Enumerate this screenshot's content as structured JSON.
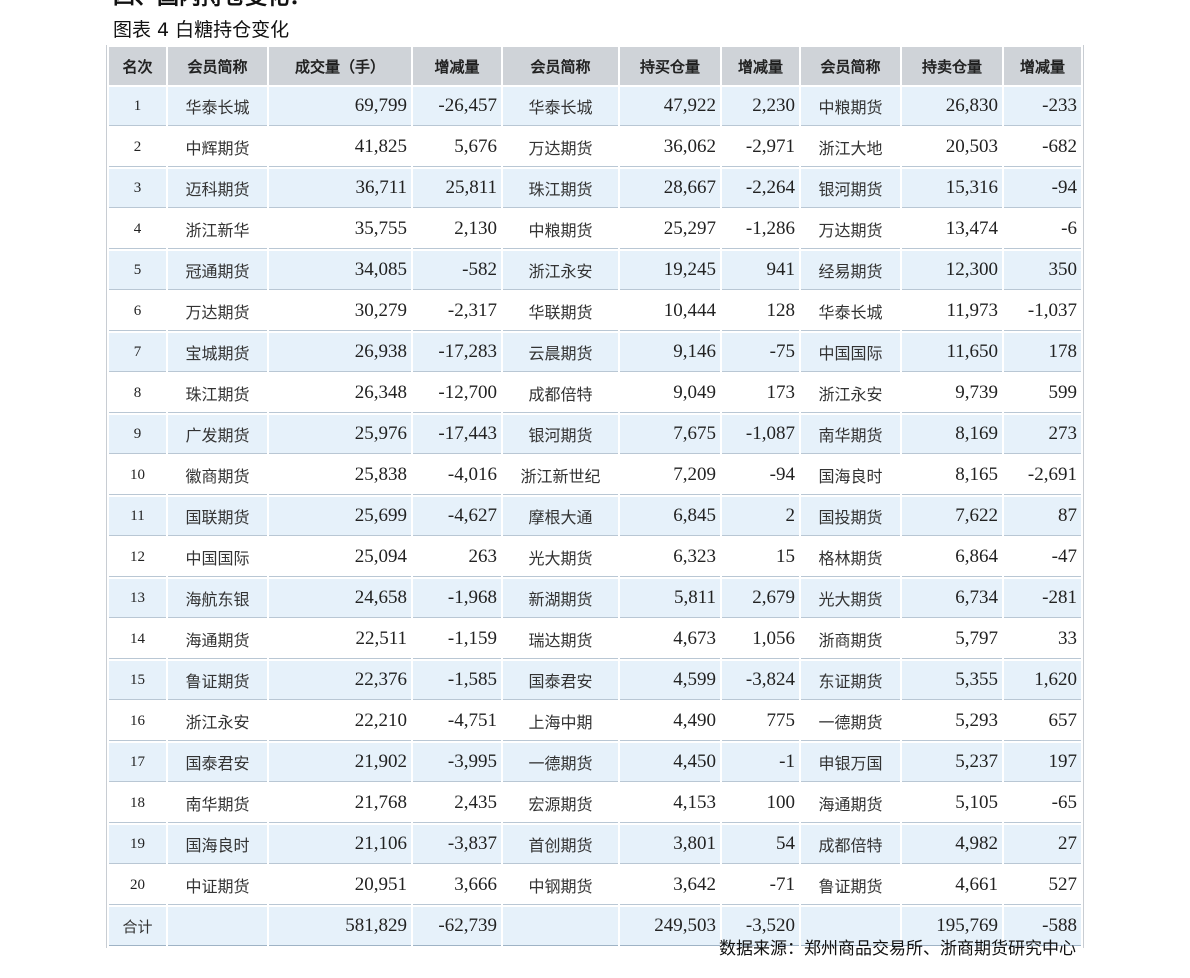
{
  "section_heading": "四、国内持仓变化：",
  "figure_title": "图表 4  白糖持仓变化",
  "columns": [
    "名次",
    "会员简称",
    "成交量（手）",
    "增减量",
    "会员简称",
    "持买仓量",
    "增减量",
    "会员简称",
    "持卖仓量",
    "增减量"
  ],
  "rows": [
    [
      "1",
      "华泰长城",
      "69,799",
      "-26,457",
      "华泰长城",
      "47,922",
      "2,230",
      "中粮期货",
      "26,830",
      "-233"
    ],
    [
      "2",
      "中辉期货",
      "41,825",
      "5,676",
      "万达期货",
      "36,062",
      "-2,971",
      "浙江大地",
      "20,503",
      "-682"
    ],
    [
      "3",
      "迈科期货",
      "36,711",
      "25,811",
      "珠江期货",
      "28,667",
      "-2,264",
      "银河期货",
      "15,316",
      "-94"
    ],
    [
      "4",
      "浙江新华",
      "35,755",
      "2,130",
      "中粮期货",
      "25,297",
      "-1,286",
      "万达期货",
      "13,474",
      "-6"
    ],
    [
      "5",
      "冠通期货",
      "34,085",
      "-582",
      "浙江永安",
      "19,245",
      "941",
      "经易期货",
      "12,300",
      "350"
    ],
    [
      "6",
      "万达期货",
      "30,279",
      "-2,317",
      "华联期货",
      "10,444",
      "128",
      "华泰长城",
      "11,973",
      "-1,037"
    ],
    [
      "7",
      "宝城期货",
      "26,938",
      "-17,283",
      "云晨期货",
      "9,146",
      "-75",
      "中国国际",
      "11,650",
      "178"
    ],
    [
      "8",
      "珠江期货",
      "26,348",
      "-12,700",
      "成都倍特",
      "9,049",
      "173",
      "浙江永安",
      "9,739",
      "599"
    ],
    [
      "9",
      "广发期货",
      "25,976",
      "-17,443",
      "银河期货",
      "7,675",
      "-1,087",
      "南华期货",
      "8,169",
      "273"
    ],
    [
      "10",
      "徽商期货",
      "25,838",
      "-4,016",
      "浙江新世纪",
      "7,209",
      "-94",
      "国海良时",
      "8,165",
      "-2,691"
    ],
    [
      "11",
      "国联期货",
      "25,699",
      "-4,627",
      "摩根大通",
      "6,845",
      "2",
      "国投期货",
      "7,622",
      "87"
    ],
    [
      "12",
      "中国国际",
      "25,094",
      "263",
      "光大期货",
      "6,323",
      "15",
      "格林期货",
      "6,864",
      "-47"
    ],
    [
      "13",
      "海航东银",
      "24,658",
      "-1,968",
      "新湖期货",
      "5,811",
      "2,679",
      "光大期货",
      "6,734",
      "-281"
    ],
    [
      "14",
      "海通期货",
      "22,511",
      "-1,159",
      "瑞达期货",
      "4,673",
      "1,056",
      "浙商期货",
      "5,797",
      "33"
    ],
    [
      "15",
      "鲁证期货",
      "22,376",
      "-1,585",
      "国泰君安",
      "4,599",
      "-3,824",
      "东证期货",
      "5,355",
      "1,620"
    ],
    [
      "16",
      "浙江永安",
      "22,210",
      "-4,751",
      "上海中期",
      "4,490",
      "775",
      "一德期货",
      "5,293",
      "657"
    ],
    [
      "17",
      "国泰君安",
      "21,902",
      "-3,995",
      "一德期货",
      "4,450",
      "-1",
      "申银万国",
      "5,237",
      "197"
    ],
    [
      "18",
      "南华期货",
      "21,768",
      "2,435",
      "宏源期货",
      "4,153",
      "100",
      "海通期货",
      "5,105",
      "-65"
    ],
    [
      "19",
      "国海良时",
      "21,106",
      "-3,837",
      "首创期货",
      "3,801",
      "54",
      "成都倍特",
      "4,982",
      "27"
    ],
    [
      "20",
      "中证期货",
      "20,951",
      "3,666",
      "中钢期货",
      "3,642",
      "-71",
      "鲁证期货",
      "4,661",
      "527"
    ]
  ],
  "total": [
    "合计",
    "",
    "581,829",
    "-62,739",
    "",
    "249,503",
    "-3,520",
    "",
    "195,769",
    "-588"
  ],
  "source_note": "数据来源：郑州商品交易所、浙商期货研究中心"
}
